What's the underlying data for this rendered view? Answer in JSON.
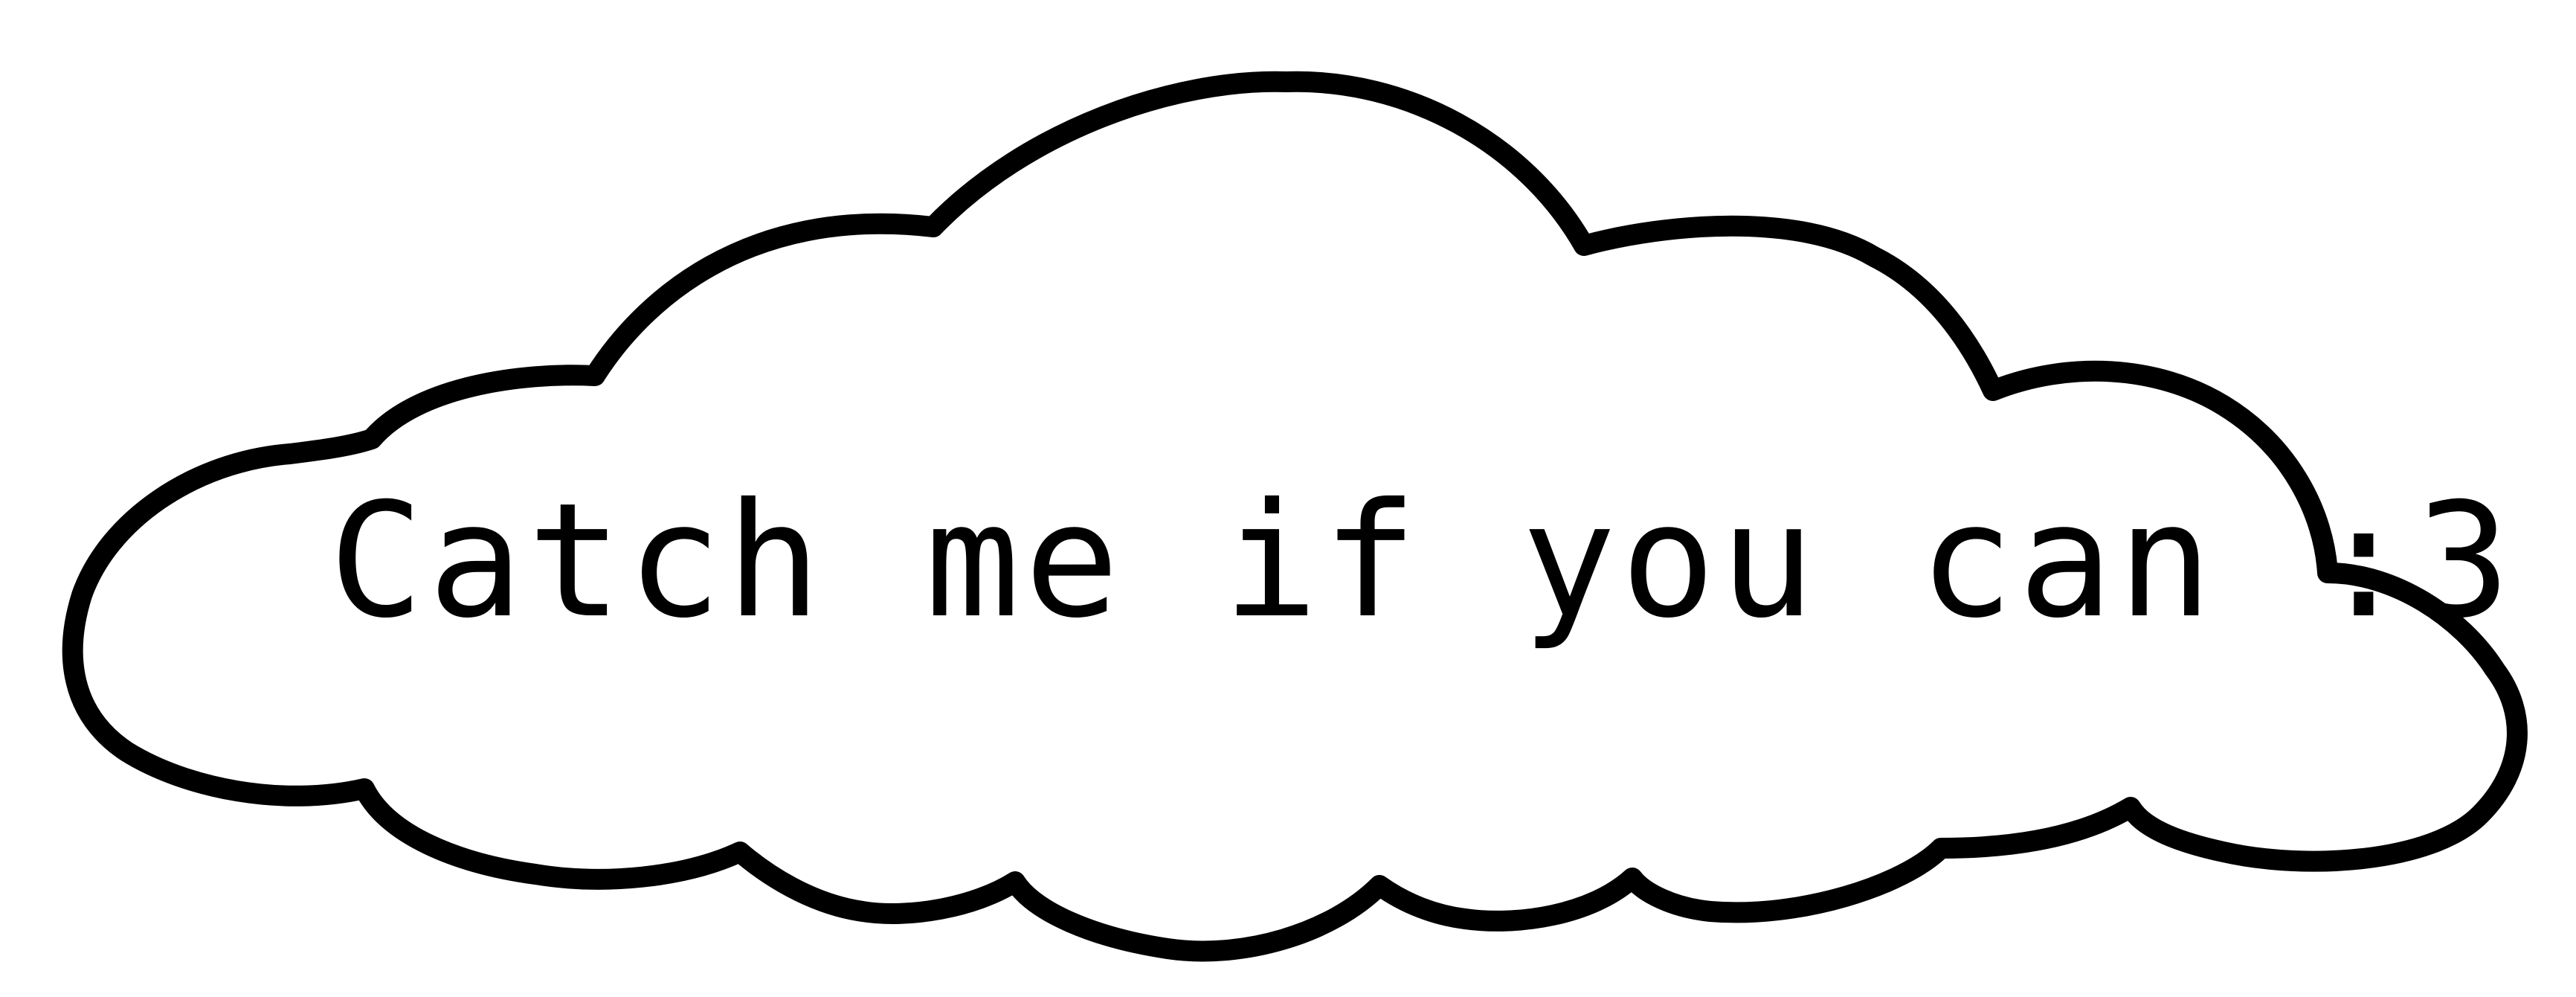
{
  "cloud": {
    "text": "Catch me if you can :3",
    "fill_color": "#ffffff",
    "outline_color": "#000000"
  }
}
